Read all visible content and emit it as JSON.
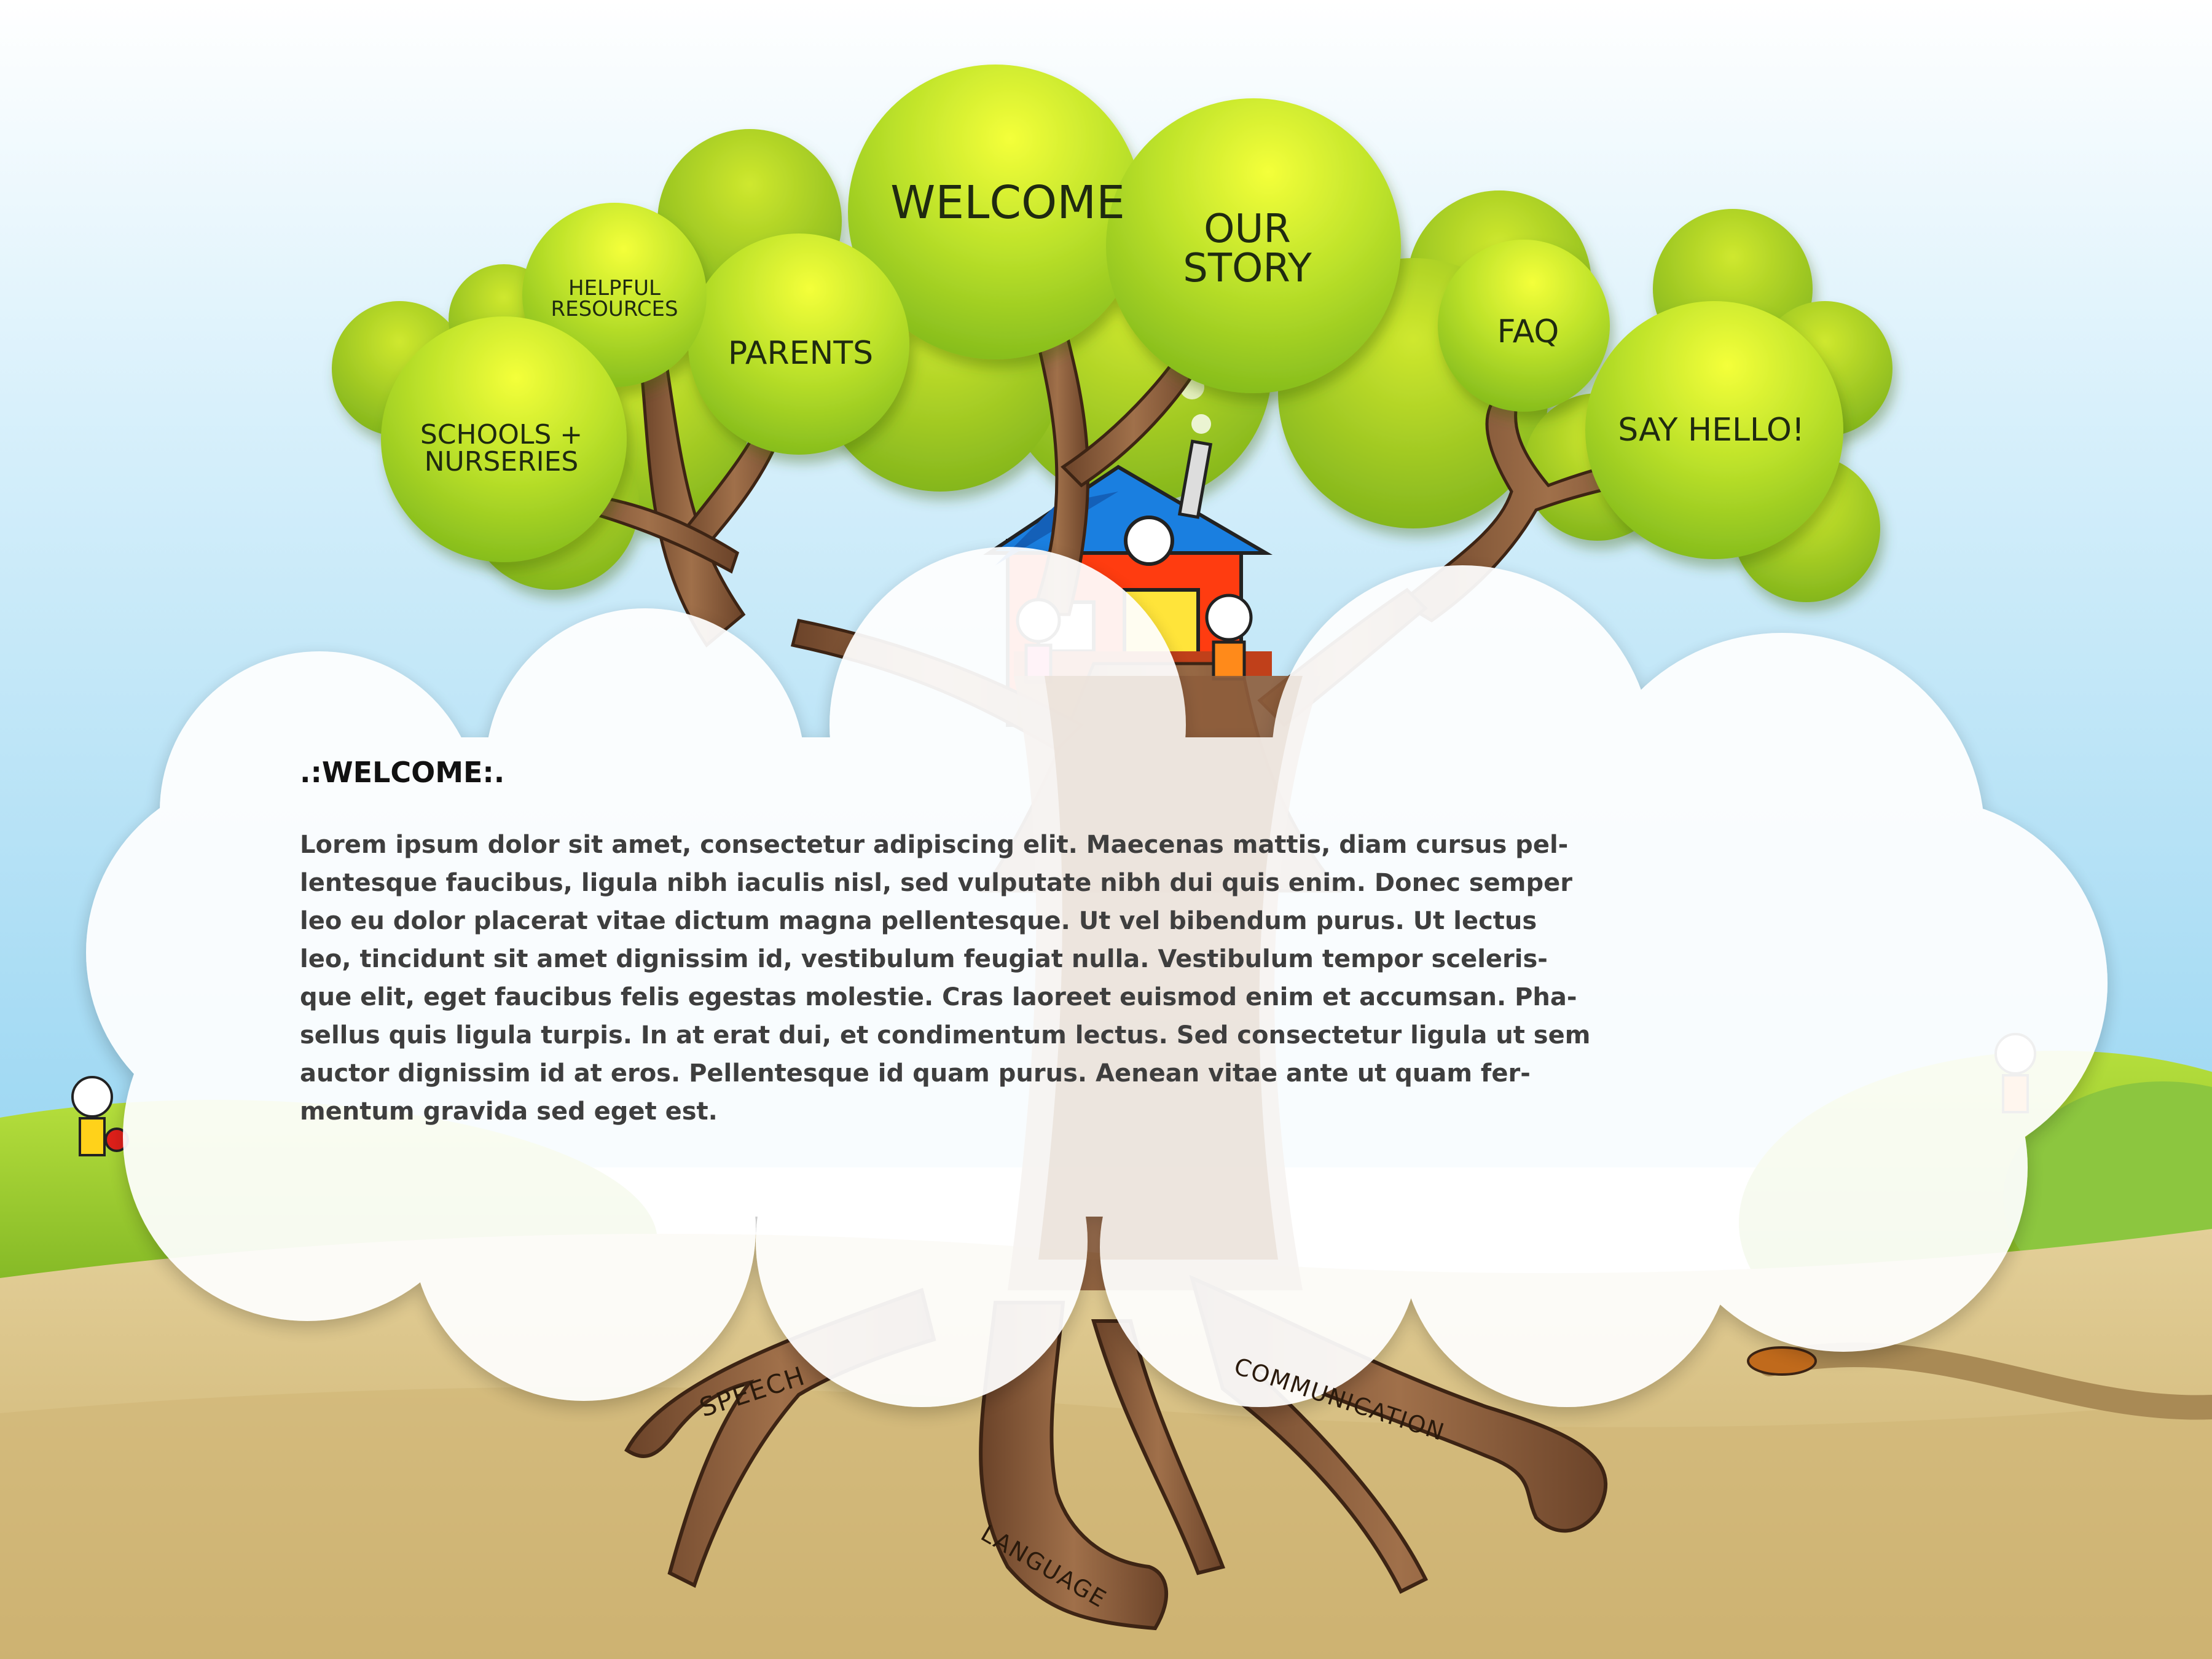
{
  "nav": {
    "welcome": "WELCOME",
    "our_story": [
      "OUR",
      "STORY"
    ],
    "faq": "FAQ",
    "parents": "PARENTS",
    "helpful_resources": [
      "HELPFUL",
      "RESOURCES"
    ],
    "schools_nurseries": [
      "SCHOOLS +",
      "NURSERIES"
    ],
    "say_hello": "SAY HELLO!"
  },
  "roots": {
    "speech": "SPEECH",
    "language": "LANGUAGE",
    "communication": "COMMUNICATION"
  },
  "content": {
    "heading": ".:WELCOME:.",
    "body_lines": [
      "Lorem ipsum dolor sit amet, consectetur adipiscing elit. Maecenas mattis, diam cursus pel-",
      "lentesque faucibus, ligula nibh iaculis nisl, sed vulputate nibh dui quis enim. Donec semper",
      "leo eu dolor placerat vitae dictum magna pellentesque. Ut vel bibendum purus. Ut lectus",
      "leo, tincidunt sit amet dignissim id, vestibulum feugiat nulla. Vestibulum tempor sceleris-",
      "que elit, eget faucibus felis egestas molestie. Cras laoreet euismod enim et accumsan. Pha-",
      "sellus quis ligula turpis. In at erat dui, et condimentum lectus. Sed consectetur ligula ut sem",
      "auctor dignissim id at eros. Pellentesque id quam purus. Aenean vitae ante ut quam fer-",
      "mentum gravida sed eget est."
    ]
  },
  "colors": {
    "sky_top": "#ffffff",
    "sky_bottom": "#a6dcf4",
    "leaf_light": "#d8f23a",
    "leaf_dark": "#86c21c",
    "grass": "#8cc63f",
    "ground": "#d6bf84",
    "bark": "#8b5a3a",
    "bark_dark": "#5a3620",
    "house_wall": "#ff3c10",
    "house_roof": "#1a7fe0",
    "cloud": "#ffffff"
  }
}
